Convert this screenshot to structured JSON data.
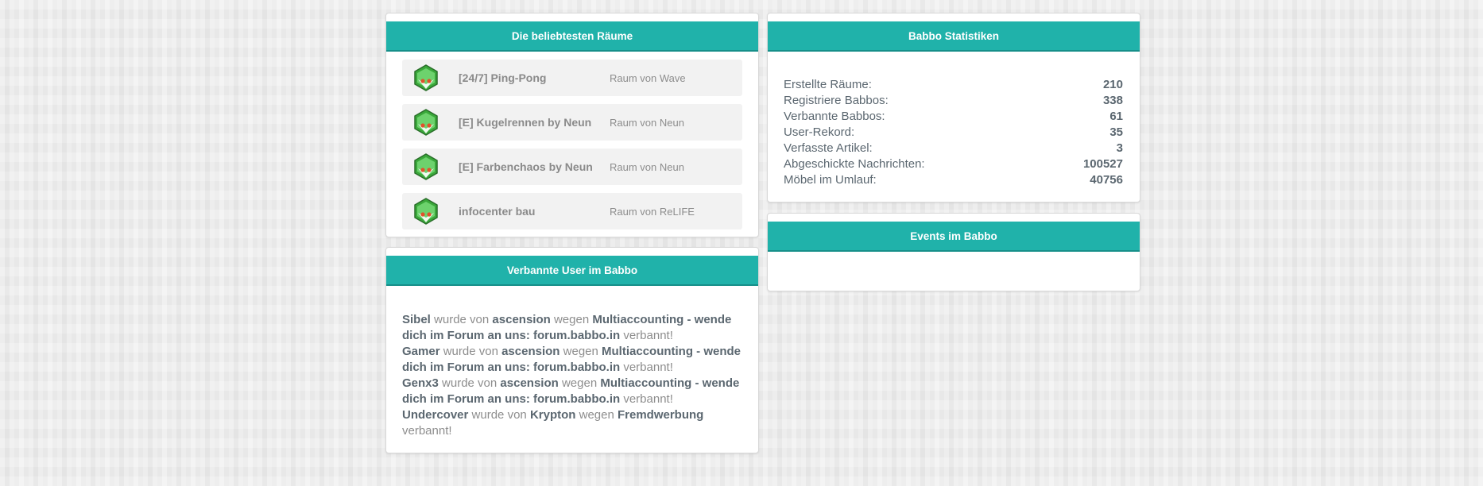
{
  "rooms_panel": {
    "title": "Die beliebtesten Räume",
    "rooms": [
      {
        "name": "[24/7] Ping-Pong",
        "owner": "Raum von Wave",
        "icon": "room-icon"
      },
      {
        "name": "[E] Kugelrennen by Neun",
        "owner": "Raum von Neun",
        "icon": "room-icon"
      },
      {
        "name": "[E] Farbenchaos by Neun",
        "owner": "Raum von Neun",
        "icon": "room-icon"
      },
      {
        "name": "infocenter bau",
        "owner": "Raum von ReLIFE",
        "icon": "room-icon"
      }
    ]
  },
  "banned_panel": {
    "title": "Verbannte User im Babbo",
    "entries": [
      {
        "user": "Sibel",
        "by_text": "wurde von",
        "by": "ascension",
        "reason_text": "wegen",
        "reason": "Multiaccounting - wende dich im Forum an uns: forum.babbo.in",
        "end_text": "verbannt!"
      },
      {
        "user": "Gamer",
        "by_text": "wurde von",
        "by": "ascension",
        "reason_text": "wegen",
        "reason": "Multiaccounting - wende dich im Forum an uns: forum.babbo.in",
        "end_text": "verbannt!"
      },
      {
        "user": "Genx3",
        "by_text": "wurde von",
        "by": "ascension",
        "reason_text": "wegen",
        "reason": "Multiaccounting - wende dich im Forum an uns: forum.babbo.in",
        "end_text": "verbannt!"
      },
      {
        "user": "Undercover",
        "by_text": "wurde von",
        "by": "Krypton",
        "reason_text": "wegen",
        "reason": "Fremdwerbung",
        "end_text": "verbannt!"
      }
    ]
  },
  "stats_panel": {
    "title": "Babbo Statistiken",
    "rows": [
      {
        "label": "Erstellte Räume:",
        "value": "210"
      },
      {
        "label": "Registriere Babbos:",
        "value": "338"
      },
      {
        "label": "Verbannte Babbos:",
        "value": "61"
      },
      {
        "label": "User-Rekord:",
        "value": "35"
      },
      {
        "label": "Verfasste Artikel:",
        "value": "3"
      },
      {
        "label": "Abgeschickte Nachrichten:",
        "value": "100527"
      },
      {
        "label": "Möbel im Umlauf:",
        "value": "40756"
      }
    ]
  },
  "events_panel": {
    "title": "Events im Babbo"
  },
  "colors": {
    "accent": "#20b2aa",
    "accent_dark": "#168f89",
    "text": "#5b6770",
    "muted": "#8d8d8d"
  }
}
